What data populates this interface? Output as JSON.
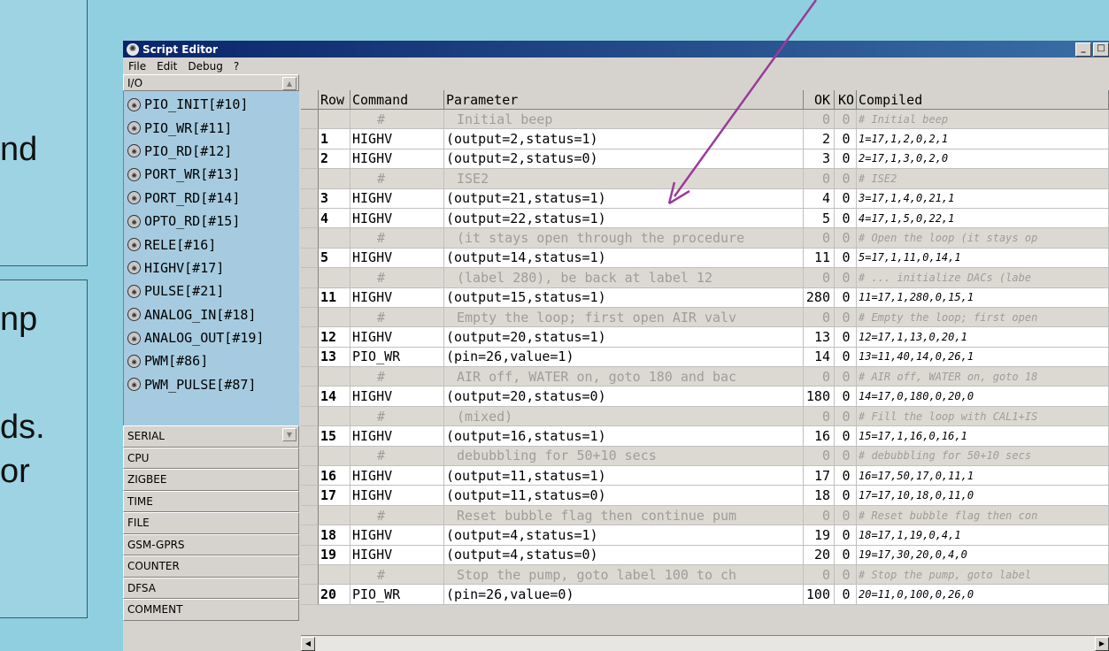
{
  "slide": {
    "fragments": [
      "nd",
      "np",
      "ds.",
      "or"
    ]
  },
  "window": {
    "title": "Script Editor",
    "controls": [
      "_",
      "□"
    ]
  },
  "menu": [
    "File",
    "Edit",
    "Debug",
    "?"
  ],
  "sidebar": {
    "io_header": "I/O",
    "io_items": [
      "PIO_INIT[#10]",
      "PIO_WR[#11]",
      "PIO_RD[#12]",
      "PORT_WR[#13]",
      "PORT_RD[#14]",
      "OPTO_RD[#15]",
      "RELE[#16]",
      "HIGHV[#17]",
      "PULSE[#21]",
      "ANALOG_IN[#18]",
      "ANALOG_OUT[#19]",
      "PWM[#86]",
      "PWM_PULSE[#87]"
    ],
    "categories": [
      "SERIAL",
      "CPU",
      "ZIGBEE",
      "TIME",
      "FILE",
      "GSM-GPRS",
      "COUNTER",
      "DFSA",
      "COMMENT"
    ]
  },
  "grid": {
    "columns": [
      "Row",
      "Command",
      "Parameter",
      "OK",
      "KO",
      "Compiled"
    ],
    "rows": [
      {
        "type": "cmt",
        "row": "",
        "command": "#",
        "parameter": "Initial beep",
        "ok": "0",
        "ko": "0",
        "compiled": "# Initial beep"
      },
      {
        "type": "cmd",
        "row": "1",
        "command": "HIGHV",
        "parameter": "(output=2,status=1)",
        "ok": "2",
        "ko": "0",
        "compiled": "1=17,1,2,0,2,1"
      },
      {
        "type": "cmd",
        "row": "2",
        "command": "HIGHV",
        "parameter": "(output=2,status=0)",
        "ok": "3",
        "ko": "0",
        "compiled": "2=17,1,3,0,2,0"
      },
      {
        "type": "cmt",
        "row": "",
        "command": "#",
        "parameter": "ISE2",
        "ok": "0",
        "ko": "0",
        "compiled": "# ISE2"
      },
      {
        "type": "cmd",
        "row": "3",
        "command": "HIGHV",
        "parameter": "(output=21,status=1)",
        "ok": "4",
        "ko": "0",
        "compiled": "3=17,1,4,0,21,1"
      },
      {
        "type": "cmd",
        "row": "4",
        "command": "HIGHV",
        "parameter": "(output=22,status=1)",
        "ok": "5",
        "ko": "0",
        "compiled": "4=17,1,5,0,22,1"
      },
      {
        "type": "cmt",
        "row": "",
        "command": "#",
        "parameter": "(it stays open through the procedure",
        "ok": "0",
        "ko": "0",
        "compiled": "# Open the loop (it stays op"
      },
      {
        "type": "cmd",
        "row": "5",
        "command": "HIGHV",
        "parameter": "(output=14,status=1)",
        "ok": "11",
        "ko": "0",
        "compiled": "5=17,1,11,0,14,1"
      },
      {
        "type": "cmt",
        "row": "",
        "command": "#",
        "parameter": "(label 280), be back at label 12",
        "ok": "0",
        "ko": "0",
        "compiled": "# ... initialize DACs (labe"
      },
      {
        "type": "cmd",
        "row": "11",
        "command": "HIGHV",
        "parameter": "(output=15,status=1)",
        "ok": "280",
        "ko": "0",
        "compiled": "11=17,1,280,0,15,1"
      },
      {
        "type": "cmt",
        "row": "",
        "command": "#",
        "parameter": "Empty the loop; first open AIR valv",
        "ok": "0",
        "ko": "0",
        "compiled": "# Empty the loop; first open"
      },
      {
        "type": "cmd",
        "row": "12",
        "command": "HIGHV",
        "parameter": "(output=20,status=1)",
        "ok": "13",
        "ko": "0",
        "compiled": "12=17,1,13,0,20,1"
      },
      {
        "type": "cmd",
        "row": "13",
        "command": "PIO_WR",
        "parameter": "(pin=26,value=1)",
        "ok": "14",
        "ko": "0",
        "compiled": "13=11,40,14,0,26,1"
      },
      {
        "type": "cmt",
        "row": "",
        "command": "#",
        "parameter": "AIR off, WATER on, goto 180 and bac",
        "ok": "0",
        "ko": "0",
        "compiled": "# AIR off, WATER on, goto 18"
      },
      {
        "type": "cmd",
        "row": "14",
        "command": "HIGHV",
        "parameter": "(output=20,status=0)",
        "ok": "180",
        "ko": "0",
        "compiled": "14=17,0,180,0,20,0"
      },
      {
        "type": "cmt",
        "row": "",
        "command": "#",
        "parameter": "(mixed)",
        "ok": "0",
        "ko": "0",
        "compiled": "# Fill the loop with CAL1+IS"
      },
      {
        "type": "cmd",
        "row": "15",
        "command": "HIGHV",
        "parameter": "(output=16,status=1)",
        "ok": "16",
        "ko": "0",
        "compiled": "15=17,1,16,0,16,1"
      },
      {
        "type": "cmt",
        "row": "",
        "command": "#",
        "parameter": "debubbling for 50+10 secs",
        "ok": "0",
        "ko": "0",
        "compiled": "# debubbling for 50+10 secs"
      },
      {
        "type": "cmd",
        "row": "16",
        "command": "HIGHV",
        "parameter": "(output=11,status=1)",
        "ok": "17",
        "ko": "0",
        "compiled": "16=17,50,17,0,11,1"
      },
      {
        "type": "cmd",
        "row": "17",
        "command": "HIGHV",
        "parameter": "(output=11,status=0)",
        "ok": "18",
        "ko": "0",
        "compiled": "17=17,10,18,0,11,0"
      },
      {
        "type": "cmt",
        "row": "",
        "command": "#",
        "parameter": "Reset bubble flag then continue pum",
        "ok": "0",
        "ko": "0",
        "compiled": "# Reset bubble flag then con"
      },
      {
        "type": "cmd",
        "row": "18",
        "command": "HIGHV",
        "parameter": "(output=4,status=1)",
        "ok": "19",
        "ko": "0",
        "compiled": "18=17,1,19,0,4,1"
      },
      {
        "type": "cmd",
        "row": "19",
        "command": "HIGHV",
        "parameter": "(output=4,status=0)",
        "ok": "20",
        "ko": "0",
        "compiled": "19=17,30,20,0,4,0"
      },
      {
        "type": "cmt",
        "row": "",
        "command": "#",
        "parameter": "Stop the pump, goto label 100 to ch",
        "ok": "0",
        "ko": "0",
        "compiled": "# Stop the pump, goto label"
      },
      {
        "type": "cmd",
        "row": "20",
        "command": "PIO_WR",
        "parameter": "(pin=26,value=0)",
        "ok": "100",
        "ko": "0",
        "compiled": "20=11,0,100,0,26,0"
      }
    ]
  },
  "colors": {
    "arrow": "#9b3a9b",
    "titlebar": "#0a246a",
    "io_panel": "#a6cbe0"
  }
}
